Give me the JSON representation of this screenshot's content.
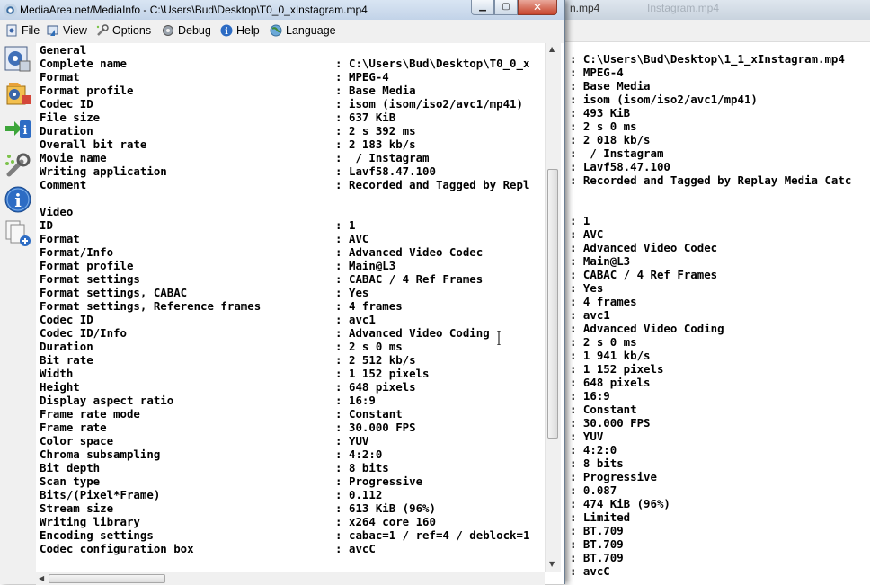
{
  "background_window": {
    "title_fragment": "n.mp4",
    "title_ghost": "Instagram.mp4",
    "lines": [
      ": C:\\Users\\Bud\\Desktop\\1_1_xInstagram.mp4",
      ": MPEG-4",
      ": Base Media",
      ": isom (isom/iso2/avc1/mp41)",
      ": 493 KiB",
      ": 2 s 0 ms",
      ": 2 018 kb/s",
      ":  / Instagram",
      ": Lavf58.47.100",
      ": Recorded and Tagged by Replay Media Catc",
      "",
      "",
      ": 1",
      ": AVC",
      ": Advanced Video Codec",
      ": Main@L3",
      ": CABAC / 4 Ref Frames",
      ": Yes",
      ": 4 frames",
      ": avc1",
      ": Advanced Video Coding",
      ": 2 s 0 ms",
      ": 1 941 kb/s",
      ": 1 152 pixels",
      ": 648 pixels",
      ": 16:9",
      ": Constant",
      ": 30.000 FPS",
      ": YUV",
      ": 4:2:0",
      ": 8 bits",
      ": Progressive",
      ": 0.087",
      ": 474 KiB (96%)",
      ": Limited",
      ": BT.709",
      ": BT.709",
      ": BT.709",
      ": avcC"
    ]
  },
  "window": {
    "title": "MediaArea.net/MediaInfo - C:\\Users\\Bud\\Desktop\\T0_0_xInstagram.mp4",
    "buttons": {
      "minimize": "▁",
      "maximize": "▢",
      "close": "✕"
    }
  },
  "menu": {
    "file": "File",
    "view": "View",
    "options": "Options",
    "debug": "Debug",
    "help": "Help",
    "language": "Language"
  },
  "sidebar_icons": [
    "basic-view-icon",
    "sheet-view-icon",
    "export-icon",
    "preferences-icon",
    "about-info-icon",
    "open-files-icon"
  ],
  "info": [
    {
      "k": "General"
    },
    {
      "k": "Complete name",
      "v": "C:\\Users\\Bud\\Desktop\\T0_0_x"
    },
    {
      "k": "Format",
      "v": "MPEG-4"
    },
    {
      "k": "Format profile",
      "v": "Base Media"
    },
    {
      "k": "Codec ID",
      "v": "isom (isom/iso2/avc1/mp41)"
    },
    {
      "k": "File size",
      "v": "637 KiB"
    },
    {
      "k": "Duration",
      "v": "2 s 392 ms"
    },
    {
      "k": "Overall bit rate",
      "v": "2 183 kb/s"
    },
    {
      "k": "Movie name",
      "v": " / Instagram"
    },
    {
      "k": "Writing application",
      "v": "Lavf58.47.100"
    },
    {
      "k": "Comment",
      "v": "Recorded and Tagged by Repl"
    },
    {
      "k": ""
    },
    {
      "k": "Video"
    },
    {
      "k": "ID",
      "v": "1"
    },
    {
      "k": "Format",
      "v": "AVC"
    },
    {
      "k": "Format/Info",
      "v": "Advanced Video Codec"
    },
    {
      "k": "Format profile",
      "v": "Main@L3"
    },
    {
      "k": "Format settings",
      "v": "CABAC / 4 Ref Frames"
    },
    {
      "k": "Format settings, CABAC",
      "v": "Yes"
    },
    {
      "k": "Format settings, Reference frames",
      "v": "4 frames"
    },
    {
      "k": "Codec ID",
      "v": "avc1"
    },
    {
      "k": "Codec ID/Info",
      "v": "Advanced Video Coding"
    },
    {
      "k": "Duration",
      "v": "2 s 0 ms"
    },
    {
      "k": "Bit rate",
      "v": "2 512 kb/s"
    },
    {
      "k": "Width",
      "v": "1 152 pixels"
    },
    {
      "k": "Height",
      "v": "648 pixels"
    },
    {
      "k": "Display aspect ratio",
      "v": "16:9"
    },
    {
      "k": "Frame rate mode",
      "v": "Constant"
    },
    {
      "k": "Frame rate",
      "v": "30.000 FPS"
    },
    {
      "k": "Color space",
      "v": "YUV"
    },
    {
      "k": "Chroma subsampling",
      "v": "4:2:0"
    },
    {
      "k": "Bit depth",
      "v": "8 bits"
    },
    {
      "k": "Scan type",
      "v": "Progressive"
    },
    {
      "k": "Bits/(Pixel*Frame)",
      "v": "0.112"
    },
    {
      "k": "Stream size",
      "v": "613 KiB (96%)"
    },
    {
      "k": "Writing library",
      "v": "x264 core 160"
    },
    {
      "k": "Encoding settings",
      "v": "cabac=1 / ref=4 / deblock=1"
    },
    {
      "k": "Codec configuration box",
      "v": "avcC"
    }
  ],
  "colon": ":",
  "colors": {
    "titlebar": "#c9d9ec",
    "close_button": "#c7442c",
    "window_bg": "#ffffff",
    "chrome": "#f0f0f0"
  }
}
